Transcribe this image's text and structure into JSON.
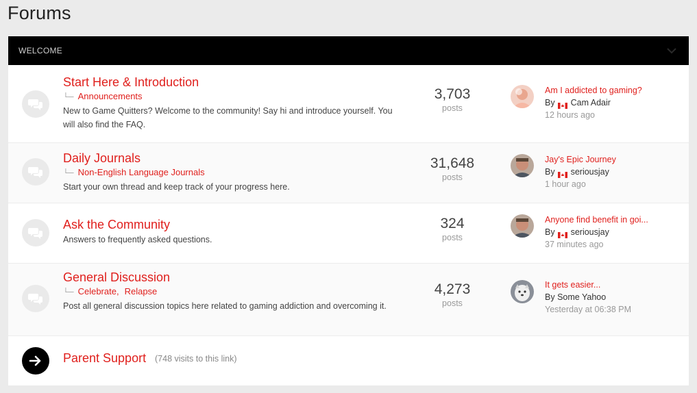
{
  "page": {
    "title": "Forums"
  },
  "category": {
    "name": "WELCOME"
  },
  "forums": [
    {
      "title": "Start Here & Introduction",
      "subforums": [
        "Announcements"
      ],
      "description": "New to Game Quitters? Welcome to the community! Say hi and introduce yourself. You will also find the FAQ.",
      "posts_count": "3,703",
      "posts_label": "posts",
      "last_post": {
        "title": "Am I addicted to gaming?",
        "by_prefix": "By",
        "author": "Cam Adair",
        "flag": "canada-flag-icon",
        "time": "12 hours ago"
      }
    },
    {
      "title": "Daily Journals",
      "subforums": [
        "Non-English Language Journals"
      ],
      "description": "Start your own thread and keep track of your progress here.",
      "posts_count": "31,648",
      "posts_label": "posts",
      "last_post": {
        "title": "Jay's Epic Journey",
        "by_prefix": "By",
        "author": "seriousjay",
        "flag": "canada-flag-icon",
        "time": "1 hour ago"
      }
    },
    {
      "title": "Ask the Community",
      "subforums": [],
      "description": "Answers to frequently asked questions.",
      "posts_count": "324",
      "posts_label": "posts",
      "last_post": {
        "title": "Anyone find benefit in goi...",
        "by_prefix": "By",
        "author": "seriousjay",
        "flag": "canada-flag-icon",
        "time": "37 minutes ago"
      }
    },
    {
      "title": "General Discussion",
      "subforums": [
        "Celebrate,",
        "Relapse"
      ],
      "description": "Post all general discussion topics here related to gaming addiction and overcoming it.",
      "posts_count": "4,273",
      "posts_label": "posts",
      "last_post": {
        "title": "It gets easier...",
        "by_prefix": "By",
        "author": "Some Yahoo",
        "time": "Yesterday at 06:38 PM"
      }
    }
  ],
  "redirect": {
    "title": "Parent Support",
    "visits": "(748 visits to this link)"
  },
  "colors": {
    "link": "#e0201d",
    "header_bg": "#000000",
    "page_bg": "#ebebeb"
  }
}
